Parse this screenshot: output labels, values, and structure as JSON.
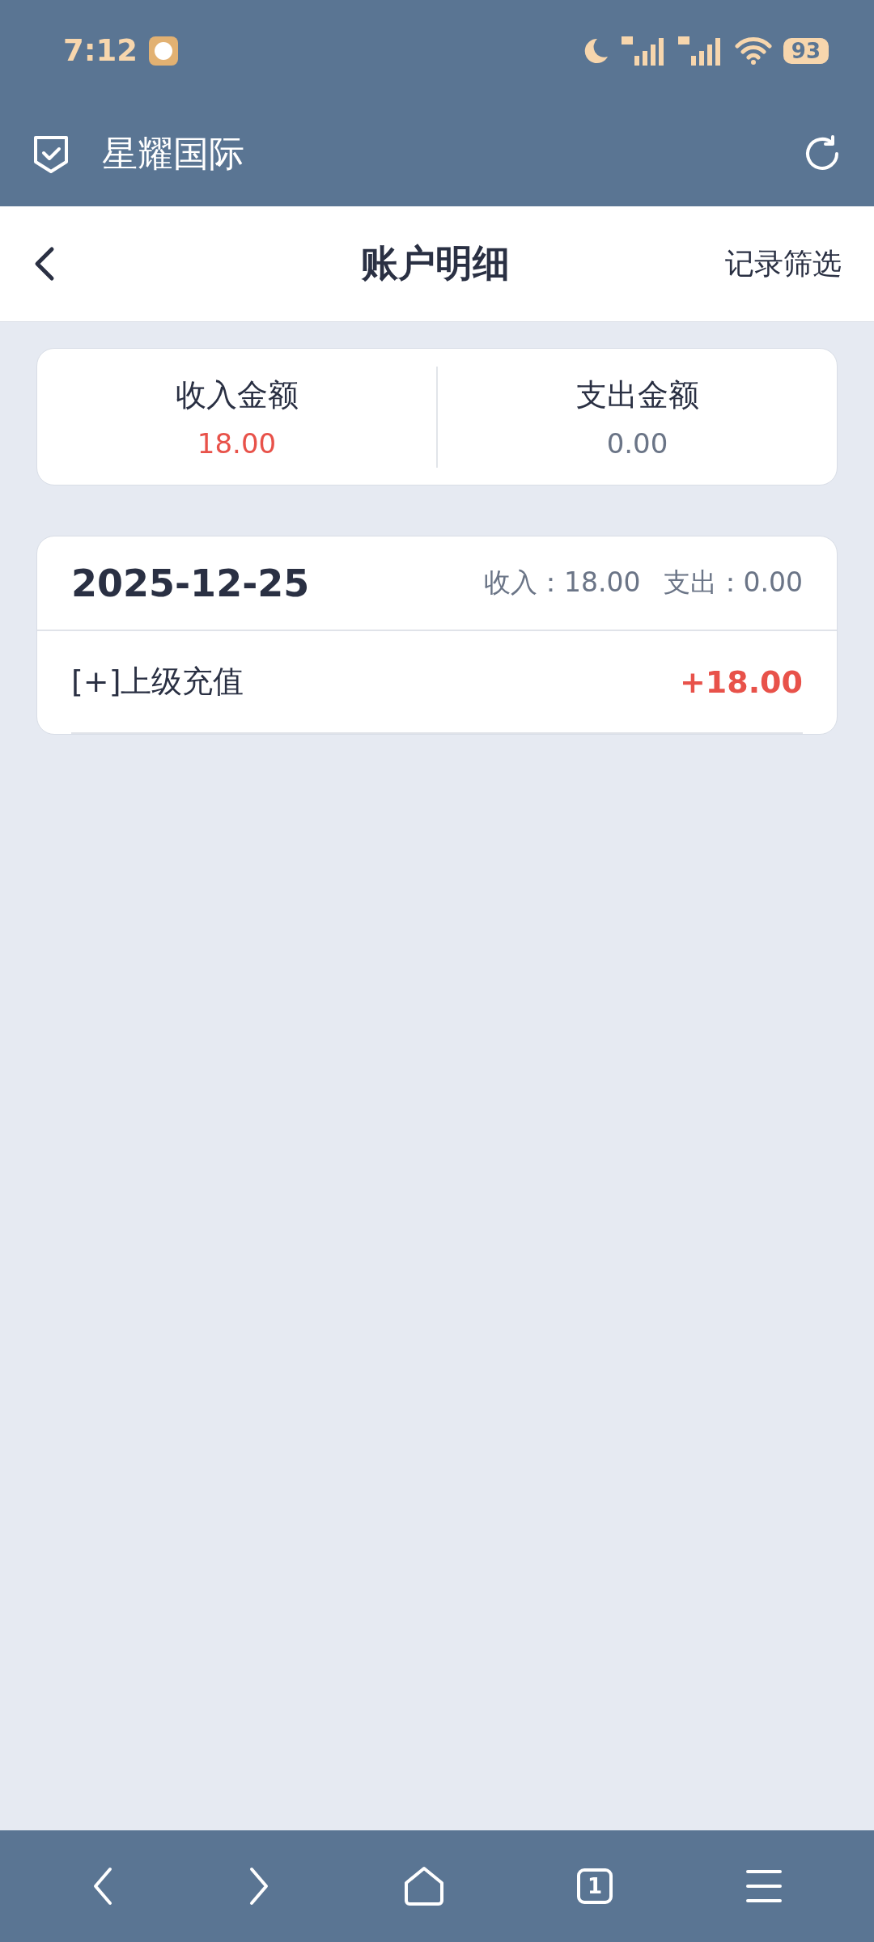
{
  "status_bar": {
    "time": "7:12",
    "battery": "93"
  },
  "app_bar": {
    "title": "星耀国际"
  },
  "nav": {
    "title": "账户明细",
    "action": "记录筛选"
  },
  "summary": [
    {
      "label": "收入金额",
      "value": "18.00",
      "kind": "income"
    },
    {
      "label": "支出金额",
      "value": "0.00",
      "kind": "expense"
    }
  ],
  "days": [
    {
      "date": "2025-12-25",
      "income": "收入：18.00",
      "expense": "支出：0.00",
      "records": [
        {
          "title": "[+]上级充值",
          "amount": "+18.00",
          "kind": "income"
        }
      ]
    }
  ],
  "bottom_nav": {
    "tabs_count": "1"
  }
}
